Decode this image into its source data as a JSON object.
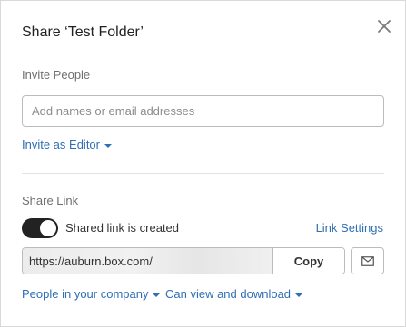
{
  "dialog": {
    "title": "Share ‘Test Folder’",
    "close_icon": "close-icon"
  },
  "invite": {
    "section_label": "Invite People",
    "input_placeholder": "Add names or email addresses",
    "input_value": "",
    "role_dropdown": "Invite as Editor"
  },
  "share_link": {
    "section_label": "Share Link",
    "toggle_on": true,
    "toggle_label": "Shared link is created",
    "settings_link": "Link Settings",
    "url_value": "https://auburn.box.com/",
    "copy_label": "Copy",
    "email_icon": "envelope-icon",
    "access_dropdown": "People in your company",
    "permission_dropdown": "Can view and download"
  },
  "colors": {
    "link": "#2f6fb5",
    "toggle_on": "#222222",
    "border": "#bcbcbc"
  }
}
